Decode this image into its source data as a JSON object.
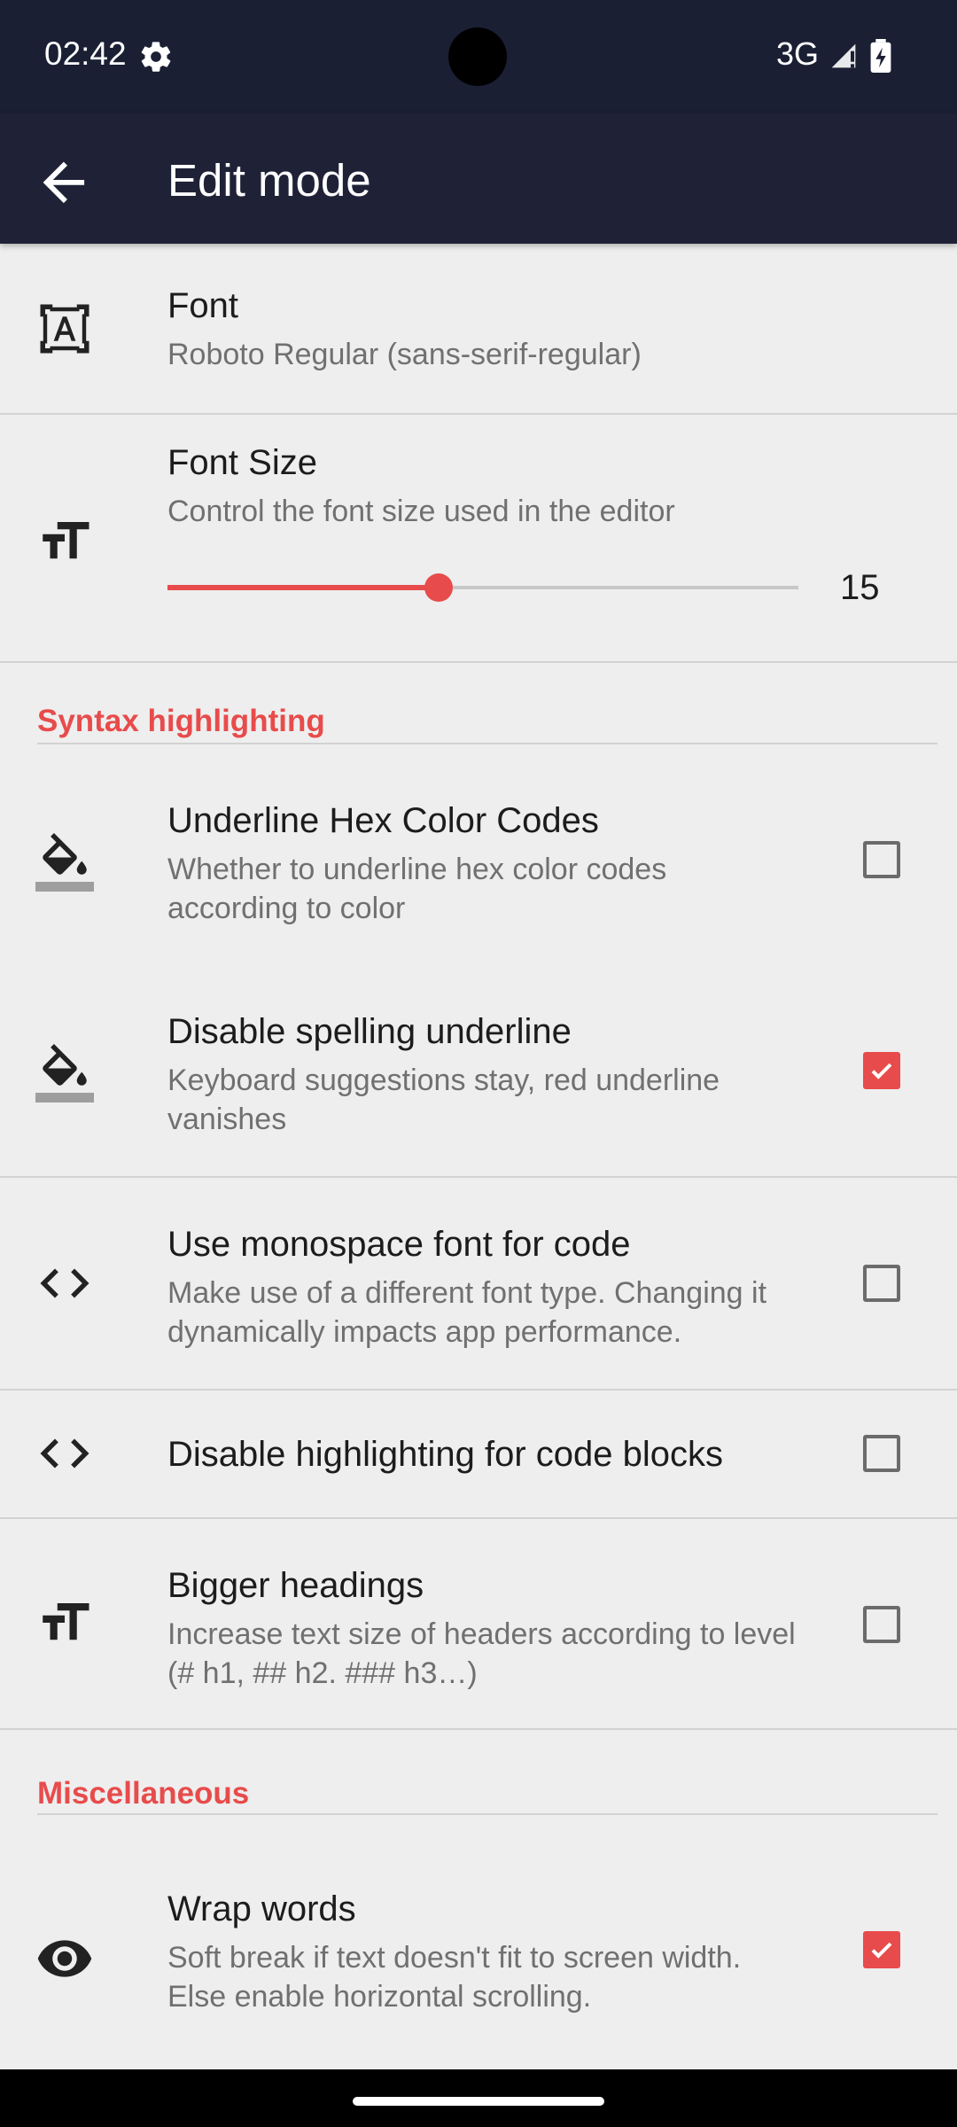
{
  "status": {
    "time": "02:42",
    "network": "3G"
  },
  "appbar": {
    "title": "Edit mode",
    "back_icon": "arrow-back-icon"
  },
  "font": {
    "title": "Font",
    "summary": "Roboto Regular (sans-serif-regular)"
  },
  "font_size": {
    "title": "Font Size",
    "summary": "Control the font size used in the editor",
    "value": "15",
    "slider_fraction": 0.43
  },
  "sections": {
    "syntax": "Syntax highlighting",
    "misc": "Miscellaneous"
  },
  "prefs": [
    {
      "title": "Underline Hex Color Codes",
      "summary": "Whether to underline hex color codes according to color",
      "checked": false,
      "icon": "format-color-fill-icon"
    },
    {
      "title": "Disable spelling underline",
      "summary": "Keyboard suggestions stay, red underline vanishes",
      "checked": true,
      "icon": "format-color-fill-icon"
    },
    {
      "title": "Use monospace font for code",
      "summary": "Make use of a different font type. Changing it dynamically impacts app performance.",
      "checked": false,
      "icon": "code-icon"
    },
    {
      "title": "Disable highlighting for code blocks",
      "summary": "",
      "checked": false,
      "icon": "code-icon"
    },
    {
      "title": "Bigger headings",
      "summary": "Increase text size of headers according to level (# h1, ## h2. ### h3…)",
      "checked": false,
      "icon": "format-size-icon"
    },
    {
      "title": "Wrap words",
      "summary": "Soft break if text doesn't fit to screen width. Else enable horizontal scrolling.",
      "checked": true,
      "icon": "eye-icon"
    }
  ],
  "colors": {
    "accent": "#e84b4b",
    "appbar": "#1f2237",
    "background": "#eeeeee"
  }
}
